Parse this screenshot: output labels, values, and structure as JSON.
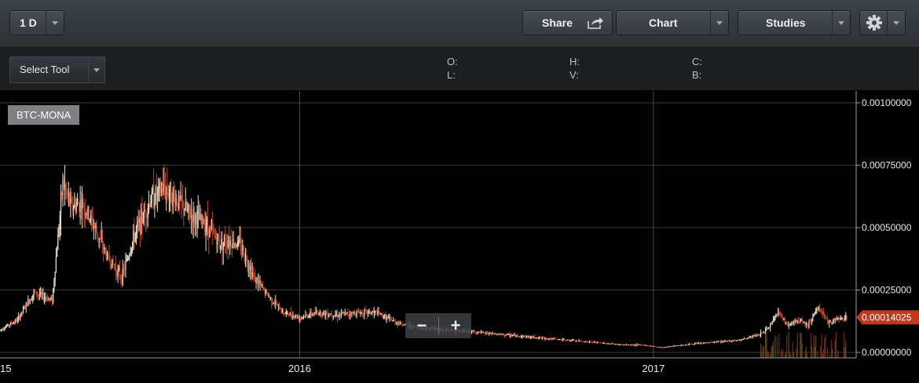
{
  "toolbar": {
    "interval_label": "1 D",
    "share_label": "Share",
    "chart_label": "Chart",
    "studies_label": "Studies"
  },
  "secondbar": {
    "select_tool_label": "Select Tool",
    "ohlc_labels": {
      "o": "O:",
      "h": "H:",
      "c": "C:",
      "l": "L:",
      "v": "V:",
      "b": "B:"
    }
  },
  "symbol": "BTC-MONA",
  "zoom": {
    "minus": "−",
    "plus": "+"
  },
  "colors": {
    "up": "#e8e0c8",
    "down": "#c8432b",
    "grid": "#3a3a3a",
    "last_price_bg": "#c0391f"
  },
  "chart_data": {
    "type": "candlestick",
    "title": "",
    "ylim": [
      0,
      0.001
    ],
    "y_ticks": [
      "0.00100000",
      "0.00075000",
      "0.00050000",
      "0.00025000",
      "0.00000000"
    ],
    "y_tick_values": [
      0.001,
      0.00075,
      0.0005,
      0.00025,
      0
    ],
    "x_tick_labels": [
      "15",
      "2016",
      "2017"
    ],
    "x_range": [
      "2015-02-25",
      "2017-07-20"
    ],
    "x_tick_dates": [
      "2015-01-01",
      "2016-01-01",
      "2017-01-01"
    ],
    "last_price": 0.00014025,
    "last_price_label": "0.00014025",
    "series": [
      {
        "dates": [
          "2015-02-25",
          "2015-03-15",
          "2015-04-01",
          "2015-04-20",
          "2015-05-01",
          "2015-05-10",
          "2015-05-20",
          "2015-06-01",
          "2015-06-15",
          "2015-07-01",
          "2015-07-15",
          "2015-08-01",
          "2015-08-15",
          "2015-09-01",
          "2015-09-10",
          "2015-09-25",
          "2015-10-10",
          "2015-10-20",
          "2015-11-01",
          "2015-11-15",
          "2015-12-01",
          "2015-12-15",
          "2016-01-01",
          "2016-01-20",
          "2016-02-10",
          "2016-03-01",
          "2016-03-20",
          "2016-04-10",
          "2016-05-01",
          "2016-06-01",
          "2016-07-01",
          "2016-08-01",
          "2016-09-01",
          "2016-10-01",
          "2016-11-01",
          "2016-12-01",
          "2016-12-20",
          "2017-01-10",
          "2017-02-01",
          "2017-03-01",
          "2017-04-01",
          "2017-04-20",
          "2017-05-01",
          "2017-05-10",
          "2017-05-20",
          "2017-06-01",
          "2017-06-10",
          "2017-06-20",
          "2017-07-01",
          "2017-07-10",
          "2017-07-20"
        ],
        "closes": [
          9e-05,
          0.00013,
          0.00024,
          0.00021,
          0.00068,
          0.00058,
          0.0006,
          0.00052,
          0.00039,
          0.0003,
          0.00048,
          0.00062,
          0.00066,
          0.00059,
          0.00055,
          0.00052,
          0.00044,
          0.00045,
          0.00043,
          0.0003,
          0.00022,
          0.00016,
          0.00014,
          0.00016,
          0.00015,
          0.00016,
          0.00016,
          0.00012,
          0.0001,
          9e-05,
          8e-05,
          7e-05,
          6e-05,
          5e-05,
          4e-05,
          3e-05,
          3e-05,
          2e-05,
          3e-05,
          4e-05,
          5e-05,
          7e-05,
          0.0001,
          0.00016,
          0.00011,
          0.00013,
          0.00011,
          0.00018,
          0.00012,
          0.00013,
          0.00014
        ]
      }
    ]
  }
}
